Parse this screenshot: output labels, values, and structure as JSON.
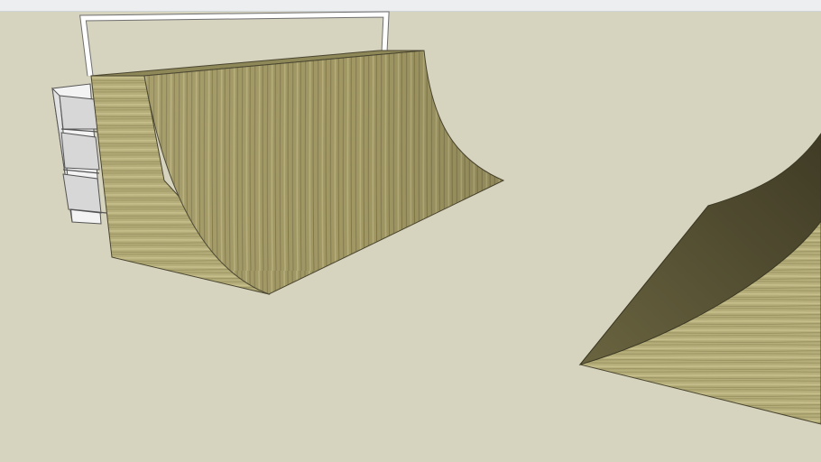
{
  "scene": {
    "background_color": "#d6d3bf",
    "wood_light": "#b9b27e",
    "wood_mid": "#9d9463",
    "wood_dark": "#5f5a3a",
    "rail_color": "#ffffff",
    "stair_color": "#ffffff"
  }
}
